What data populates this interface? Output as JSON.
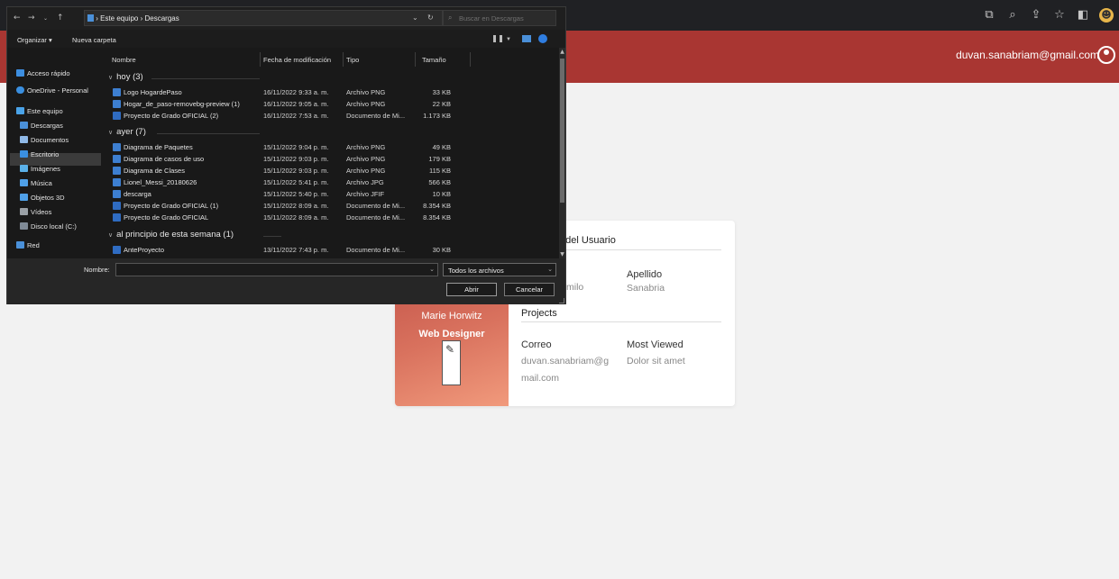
{
  "browser": {
    "icons": [
      "translate-icon",
      "zoom-icon",
      "share-icon",
      "star-icon",
      "sidebar-icon",
      "extension-icon"
    ]
  },
  "header": {
    "user_email": "duvan.sanabriam@gmail.com",
    "accent_color": "#a93632"
  },
  "profile": {
    "name": "Marie Horwitz",
    "role": "Web Designer",
    "section_info_title": "n del Usuario",
    "nombre_value_partial": "milo",
    "apellido_label": "Apellido",
    "apellido_value": "Sanabria",
    "projects_title": "Projects",
    "correo_label": "Correo",
    "correo_value_line1": "duvan.sanabriam@g",
    "correo_value_line2": "mail.com",
    "most_viewed_label": "Most Viewed",
    "most_viewed_value": "Dolor sit amet"
  },
  "dialog": {
    "breadcrumb": "› Este equipo › Descargas",
    "search_placeholder": "Buscar en Descargas",
    "toolbar": {
      "organize": "Organizar ▾",
      "new_folder": "Nueva carpeta"
    },
    "nav": [
      {
        "label": "Acceso rápido",
        "icon": "star-icon",
        "color": "#3d8ee0"
      },
      {
        "label": "OneDrive - Personal",
        "icon": "cloud-icon",
        "color": "#3a8fe0"
      },
      {
        "label": "Este equipo",
        "icon": "computer-icon",
        "color": "#4aa3e8"
      },
      {
        "label": "Descargas",
        "icon": "download-icon",
        "color": "#4a90d9"
      },
      {
        "label": "Documentos",
        "icon": "document-icon",
        "color": "#8fb8e6"
      },
      {
        "label": "Escritorio",
        "icon": "desktop-icon",
        "color": "#3a8fe0"
      },
      {
        "label": "Imágenes",
        "icon": "pictures-icon",
        "color": "#5ab0e8"
      },
      {
        "label": "Música",
        "icon": "music-icon",
        "color": "#4fa0e8"
      },
      {
        "label": "Objetos 3D",
        "icon": "cube-icon",
        "color": "#4fa0e8"
      },
      {
        "label": "Vídeos",
        "icon": "video-icon",
        "color": "#9aa0a6"
      },
      {
        "label": "Disco local (C:)",
        "icon": "drive-icon",
        "color": "#7f8a96"
      },
      {
        "label": "Red",
        "icon": "network-icon",
        "color": "#4a90d9"
      }
    ],
    "columns": {
      "name": "Nombre",
      "date": "Fecha de modificación",
      "type": "Tipo",
      "size": "Tamaño"
    },
    "groups": [
      {
        "title": "hoy (3)",
        "files": [
          {
            "name": "Logo HogardePaso",
            "date": "16/11/2022 9:33 a. m.",
            "type": "Archivo PNG",
            "size": "33 KB",
            "kind": "png"
          },
          {
            "name": "Hogar_de_paso-removebg-preview (1)",
            "date": "16/11/2022 9:05 a. m.",
            "type": "Archivo PNG",
            "size": "22 KB",
            "kind": "png"
          },
          {
            "name": "Proyecto de Grado OFICIAL (2)",
            "date": "16/11/2022 7:53 a. m.",
            "type": "Documento de Mi...",
            "size": "1.173 KB",
            "kind": "doc"
          }
        ]
      },
      {
        "title": "ayer (7)",
        "files": [
          {
            "name": "Diagrama de Paquetes",
            "date": "15/11/2022 9:04 p. m.",
            "type": "Archivo PNG",
            "size": "49 KB",
            "kind": "png"
          },
          {
            "name": "Diagrama de casos de uso",
            "date": "15/11/2022 9:03 p. m.",
            "type": "Archivo PNG",
            "size": "179 KB",
            "kind": "png"
          },
          {
            "name": "Diagrama de Clases",
            "date": "15/11/2022 9:03 p. m.",
            "type": "Archivo PNG",
            "size": "115 KB",
            "kind": "png"
          },
          {
            "name": "Lionel_Messi_20180626",
            "date": "15/11/2022 5:41 p. m.",
            "type": "Archivo JPG",
            "size": "566 KB",
            "kind": "png"
          },
          {
            "name": "descarga",
            "date": "15/11/2022 5:40 p. m.",
            "type": "Archivo JFIF",
            "size": "10 KB",
            "kind": "png"
          },
          {
            "name": "Proyecto de Grado OFICIAL (1)",
            "date": "15/11/2022 8:09 a. m.",
            "type": "Documento de Mi...",
            "size": "8.354 KB",
            "kind": "doc"
          },
          {
            "name": "Proyecto de Grado OFICIAL",
            "date": "15/11/2022 8:09 a. m.",
            "type": "Documento de Mi...",
            "size": "8.354 KB",
            "kind": "doc"
          }
        ]
      },
      {
        "title": "al principio de esta semana (1)",
        "files": [
          {
            "name": "AnteProyecto",
            "date": "13/11/2022 7:43 p. m.",
            "type": "Documento de Mi...",
            "size": "30 KB",
            "kind": "doc"
          }
        ]
      }
    ],
    "filename_label": "Nombre:",
    "filename_value": "",
    "filter_value": "Todos los archivos",
    "open_button": "Abrir",
    "cancel_button": "Cancelar"
  }
}
